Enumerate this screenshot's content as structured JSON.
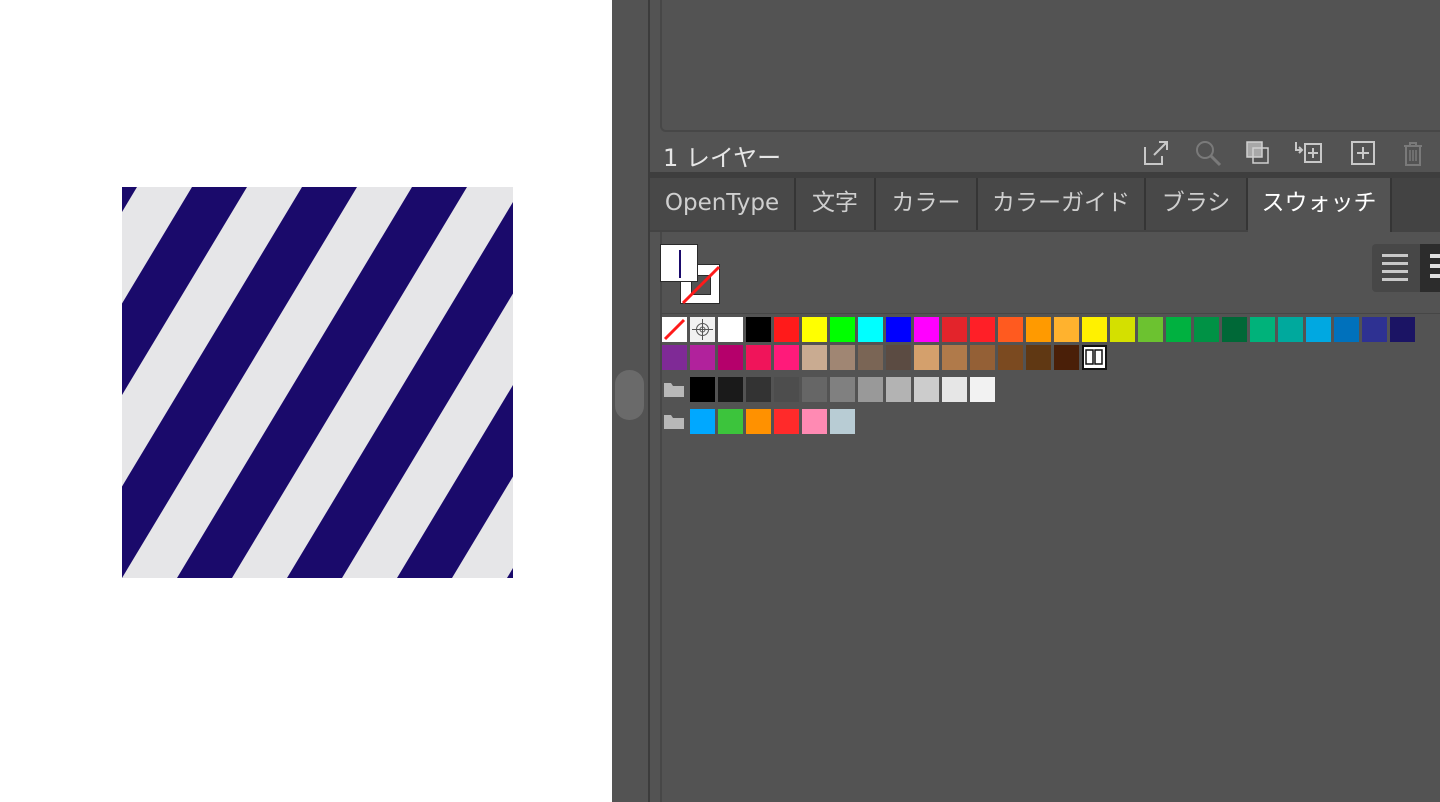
{
  "artwork": {
    "stripe_dark": "#1a0a6b",
    "stripe_light": "#e6e6e8"
  },
  "layers": {
    "count_label": "1 レイヤー",
    "footer_icons": [
      "export-icon",
      "search-icon",
      "clipping-mask-icon",
      "move-to-layer-icon",
      "new-sublayer-icon",
      "trash-icon"
    ]
  },
  "tabs": [
    {
      "label": "OpenType",
      "active": false
    },
    {
      "label": "文字",
      "active": false
    },
    {
      "label": "カラー",
      "active": false
    },
    {
      "label": "カラーガイド",
      "active": false
    },
    {
      "label": "ブラシ",
      "active": false
    },
    {
      "label": "スウォッチ",
      "active": true
    }
  ],
  "fill_stroke": {
    "fill": "#ffffff",
    "stroke": "none"
  },
  "swatches": {
    "row1": [
      "none",
      "registration",
      "#ffffff",
      "#000000",
      "#ff1a1a",
      "#ffff00",
      "#00ff00",
      "#00ffff",
      "#0000ff",
      "#ff00ff",
      "#e3242b",
      "#ff1f27",
      "#ff5a1f",
      "#ff9a00",
      "#ffb22e",
      "#fff100",
      "#d4e000",
      "#6cc230",
      "#00b140",
      "#009245",
      "#006837",
      "#00b27a",
      "#00a99d",
      "#00a8e1",
      "#0071bc",
      "#2e3192",
      "#1b1464"
    ],
    "row2": [
      "#7f2a96",
      "#b1229c",
      "#b5006b",
      "#f0145a",
      "#ff1a7a",
      "#c9ab91",
      "#a08673",
      "#7a6555",
      "#5b4b42",
      "#d4a06c",
      "#b07a4a",
      "#946036",
      "#7b4a20",
      "#603813",
      "#4a1f08",
      "pattern"
    ],
    "group1": [
      "#000000",
      "#1a1a1a",
      "#333333",
      "#4d4d4d",
      "#666666",
      "#808080",
      "#999999",
      "#b3b3b3",
      "#cccccc",
      "#e6e6e6",
      "#f2f2f2"
    ],
    "group2": [
      "#00a8ff",
      "#3cc43c",
      "#ff9100",
      "#ff2a2a",
      "#ff8ab3",
      "#b8ccd4"
    ]
  }
}
